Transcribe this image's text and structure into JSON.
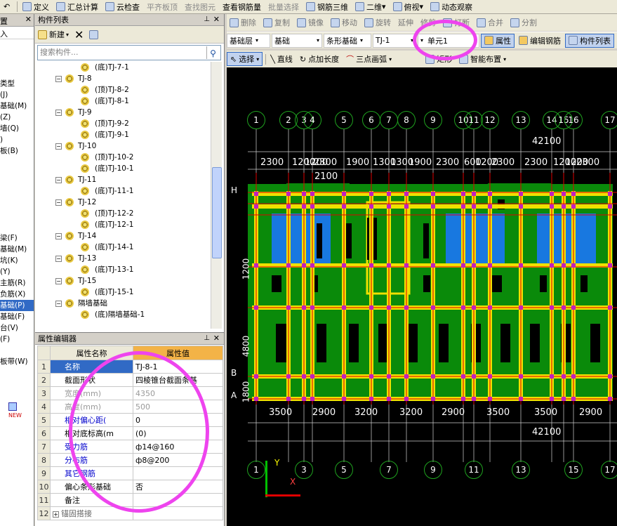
{
  "top_toolbar": {
    "items": [
      "定义",
      "汇总计算",
      "云检查",
      "平齐板顶",
      "查找图元",
      "查看钢筋量",
      "批量选择",
      "钢筋三维",
      "二维",
      "俯视",
      "动态观察"
    ]
  },
  "left_panel": {
    "header": "置",
    "sub": "入",
    "items": [
      "类型",
      "(J)",
      "基础(M)",
      "(Z)",
      "墙(Q)",
      ")",
      "板(B)",
      "",
      "",
      "",
      "",
      "",
      "",
      "",
      "梁(F)",
      "基础(M)",
      "坑(K)",
      "(Y)",
      "主筋(R)",
      "负筋(X)",
      "基础(P)",
      "基础(F)",
      "台(V)",
      "(F)",
      "",
      "板带(W)"
    ]
  },
  "component_list": {
    "title": "构件列表",
    "new_label": "新建",
    "search_placeholder": "搜索构件...",
    "tree": [
      {
        "level": 2,
        "label": "(底)TJ-7-1"
      },
      {
        "level": 1,
        "label": "TJ-8"
      },
      {
        "level": 2,
        "label": "(顶)TJ-8-2"
      },
      {
        "level": 2,
        "label": "(底)TJ-8-1"
      },
      {
        "level": 1,
        "label": "TJ-9"
      },
      {
        "level": 2,
        "label": "(顶)TJ-9-2"
      },
      {
        "level": 2,
        "label": "(底)TJ-9-1"
      },
      {
        "level": 1,
        "label": "TJ-10"
      },
      {
        "level": 2,
        "label": "(顶)TJ-10-2"
      },
      {
        "level": 2,
        "label": "(底)TJ-10-1"
      },
      {
        "level": 1,
        "label": "TJ-11"
      },
      {
        "level": 2,
        "label": "(底)TJ-11-1"
      },
      {
        "level": 1,
        "label": "TJ-12"
      },
      {
        "level": 2,
        "label": "(顶)TJ-12-2"
      },
      {
        "level": 2,
        "label": "(底)TJ-12-1"
      },
      {
        "level": 1,
        "label": "TJ-14"
      },
      {
        "level": 2,
        "label": "(底)TJ-14-1"
      },
      {
        "level": 1,
        "label": "TJ-13"
      },
      {
        "level": 2,
        "label": "(底)TJ-13-1"
      },
      {
        "level": 1,
        "label": "TJ-15"
      },
      {
        "level": 2,
        "label": "(底)TJ-15-1"
      },
      {
        "level": 1,
        "label": "隔墙基础"
      },
      {
        "level": 2,
        "label": "(底)隔墙基础-1"
      }
    ]
  },
  "property_editor": {
    "title": "属性编辑器",
    "col_name": "属性名称",
    "col_value": "属性值",
    "rows": [
      {
        "n": "1",
        "name": "名称",
        "value": "TJ-8-1",
        "style": "sel"
      },
      {
        "n": "2",
        "name": "截面形状",
        "value": "四棱锥台截面条基",
        "style": ""
      },
      {
        "n": "3",
        "name": "宽度(mm)",
        "value": "4350",
        "style": "gray"
      },
      {
        "n": "4",
        "name": "高度(mm)",
        "value": "500",
        "style": "gray"
      },
      {
        "n": "5",
        "name": "相对偏心距(",
        "value": "0",
        "style": "blue"
      },
      {
        "n": "6",
        "name": "相对底标高(m",
        "value": "(0)",
        "style": ""
      },
      {
        "n": "7",
        "name": "受力筋",
        "value": "ф14@160",
        "style": "blue"
      },
      {
        "n": "8",
        "name": "分布筋",
        "value": "ф8@200",
        "style": "blue"
      },
      {
        "n": "9",
        "name": "其它钢筋",
        "value": "",
        "style": "blue"
      },
      {
        "n": "10",
        "name": "偏心条形基础",
        "value": "否",
        "style": ""
      },
      {
        "n": "11",
        "name": "备注",
        "value": "",
        "style": ""
      },
      {
        "n": "12",
        "name": "锚固搭接",
        "value": "",
        "style": "plus"
      }
    ]
  },
  "edit_toolbar": {
    "items": [
      "删除",
      "复制",
      "镜像",
      "移动",
      "旋转",
      "延伸",
      "修剪",
      "打断",
      "合并",
      "分割"
    ]
  },
  "selector_bar": {
    "floor": "基础层",
    "category": "基础",
    "type": "条形基础",
    "component": "TJ-1",
    "unit": "单元1",
    "btn_props": "属性",
    "btn_edit": "编辑钢筋",
    "btn_list": "构件列表"
  },
  "draw_bar": {
    "items": [
      "选择",
      "直线",
      "点加长度",
      "三点画弧",
      "矩形",
      "智能布置"
    ]
  },
  "canvas": {
    "top_axes": [
      "1",
      "2",
      "3",
      "4",
      "5",
      "6",
      "7",
      "8",
      "9",
      "10",
      "11",
      "12",
      "13",
      "14",
      "15",
      "16",
      "17"
    ],
    "top_total": "42100",
    "top_dims": [
      "2300",
      "1200",
      "1200",
      "2300",
      "1900",
      "1300",
      "1300",
      "1900",
      "2300",
      "600",
      "1200",
      "2300",
      "2300",
      "1200",
      "1200",
      "2300"
    ],
    "sub_dim": "2100",
    "left_dims": [
      "1200",
      "4800",
      "1800"
    ],
    "left_rows": [
      "H",
      "B",
      "A"
    ],
    "bottom_dims": [
      "3500",
      "2900",
      "3200",
      "3200",
      "2900",
      "3500",
      "3500",
      "2900"
    ],
    "bottom_total": "42100",
    "bottom_axes": [
      "1",
      "3",
      "5",
      "7",
      "9",
      "11",
      "13",
      "15",
      "17"
    ],
    "axis_y": "Y",
    "axis_x": "X"
  }
}
